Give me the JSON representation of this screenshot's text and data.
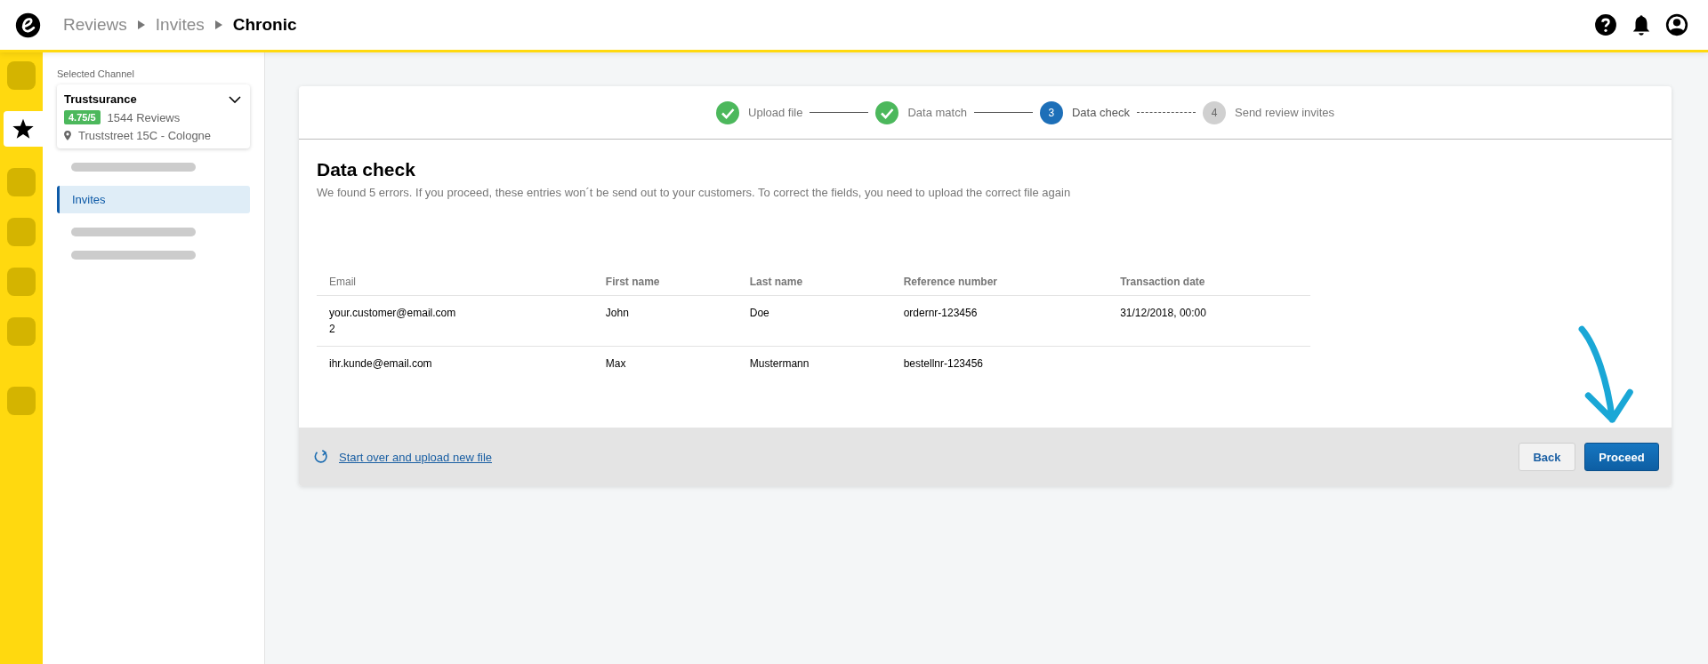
{
  "breadcrumb": [
    {
      "label": "Reviews",
      "current": false
    },
    {
      "label": "Invites",
      "current": false
    },
    {
      "label": "Chronic",
      "current": true
    }
  ],
  "rail": [
    {
      "selected": false
    },
    {
      "selected": true
    },
    {
      "selected": false
    },
    {
      "selected": false
    },
    {
      "selected": false
    },
    {
      "selected": false
    },
    {
      "selected": false,
      "kind": "gap"
    }
  ],
  "sidebar": {
    "caption": "Selected Channel",
    "channel": {
      "name": "Trustsurance",
      "rating": "4.75/5",
      "reviews": "1544 Reviews",
      "address": "Truststreet 15C - Cologne"
    },
    "items": [
      {
        "kind": "placeholder",
        "selected": false
      },
      {
        "kind": "link",
        "label": "Invites",
        "selected": true
      },
      {
        "kind": "placeholder",
        "selected": false
      },
      {
        "kind": "placeholder",
        "selected": false
      }
    ]
  },
  "steps": [
    {
      "label": "Upload file",
      "done": true,
      "selected": false
    },
    {
      "label": "Data match",
      "done": true,
      "selected": false
    },
    {
      "label": "Data check",
      "done": false,
      "selected": true,
      "number": "3"
    },
    {
      "label": "Send review invites",
      "done": false,
      "selected": false,
      "number": "4"
    }
  ],
  "title": "Data check",
  "description": "We found 5 errors. If you proceed, these entries won´t be send out to your customers. To correct the fields, you need to upload the correct file again",
  "table": {
    "columns": [
      "Email",
      "First name",
      "Last name",
      "Reference number",
      "Transaction date"
    ],
    "rows": [
      [
        "your.customer@email.com\n2",
        "John",
        "Doe",
        "ordernr-123456",
        "31/12/2018, 00:00"
      ],
      [
        "ihr.kunde@email.com",
        "Max",
        "Mustermann",
        "bestellnr-123456",
        ""
      ]
    ]
  },
  "footer": {
    "restart_link": "Start over and upload new file",
    "buttons": [
      {
        "label": "Back",
        "kind": "secondary"
      },
      {
        "label": "Proceed",
        "kind": "primary"
      }
    ]
  }
}
